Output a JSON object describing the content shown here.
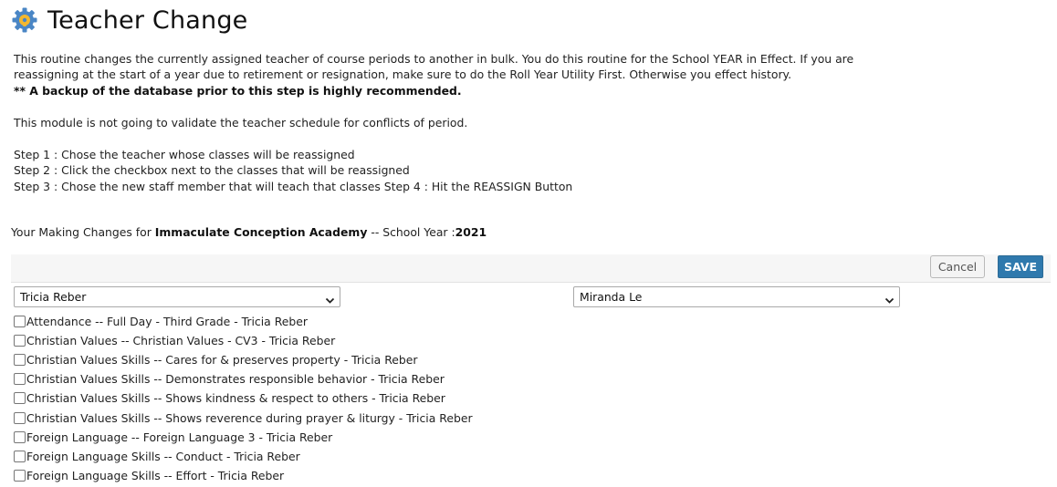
{
  "header": {
    "title": "Teacher Change",
    "icon": "gear-wrench-icon",
    "icon_colors": {
      "gear": "#4a86c5",
      "wrench": "#f5b82e"
    }
  },
  "description": {
    "line1": "This routine changes the currently assigned teacher of course periods to another in bulk. You do this routine for the School YEAR in Effect. If you are",
    "line2": "reassigning at the start of a year due to retirement or resignation, make sure to do the Roll Year Utility First. Otherwise you effect history.",
    "warning": "** A backup of the database prior to this step is highly recommended.",
    "note": "This module is not going to validate the teacher schedule for conflicts of period.",
    "step1": "Step 1 : Chose the teacher whose classes will be reassigned",
    "step2": "Step 2 : Click the checkbox next to the classes that will be reassigned",
    "step3": "Step 3 : Chose the new staff member that will teach that classes Step 4 : Hit the REASSIGN Button"
  },
  "context": {
    "prefix": "Your Making Changes for ",
    "school": "Immaculate Conception Academy",
    "middle": " -- School Year :",
    "year": "2021"
  },
  "toolbar": {
    "cancel_label": "Cancel",
    "save_label": "SAVE",
    "save_color": "#2f79ad"
  },
  "from_teacher": {
    "selected": "Tricia Reber"
  },
  "to_teacher": {
    "selected": "Miranda Le"
  },
  "courses": [
    {
      "label": "Attendance -- Full Day - Third Grade - Tricia Reber",
      "checked": false
    },
    {
      "label": "Christian Values -- Christian Values - CV3 - Tricia Reber",
      "checked": false
    },
    {
      "label": "Christian Values Skills -- Cares for & preserves property - Tricia Reber",
      "checked": false
    },
    {
      "label": "Christian Values Skills -- Demonstrates responsible behavior - Tricia Reber",
      "checked": false
    },
    {
      "label": "Christian Values Skills -- Shows kindness & respect to others - Tricia Reber",
      "checked": false
    },
    {
      "label": "Christian Values Skills -- Shows reverence during prayer & liturgy - Tricia Reber",
      "checked": false
    },
    {
      "label": "Foreign Language -- Foreign Language 3 - Tricia Reber",
      "checked": false
    },
    {
      "label": "Foreign Language Skills -- Conduct - Tricia Reber",
      "checked": false
    },
    {
      "label": "Foreign Language Skills -- Effort - Tricia Reber",
      "checked": false
    }
  ]
}
